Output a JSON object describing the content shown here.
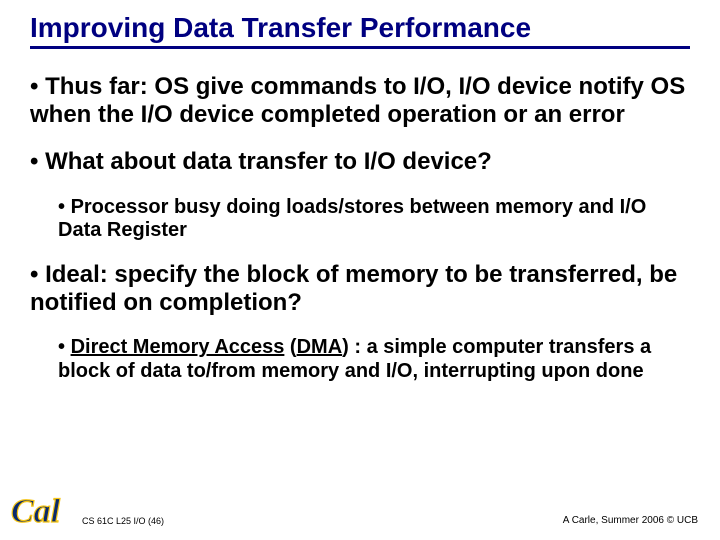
{
  "title": "Improving Data Transfer Performance",
  "bullet1": "Thus far: OS give commands to I/O, I/O device notify OS when the I/O device completed operation or an error",
  "bullet2": "What about data transfer to I/O device?",
  "bullet2a": "Processor busy doing loads/stores between memory and I/O Data Register",
  "bullet3": "Ideal: specify the block of memory to be transferred, be notified on completion?",
  "bullet3a_pre": "Direct Memory Access",
  "bullet3a_mid": " (",
  "bullet3a_dma": "DMA",
  "bullet3a_post": ") : a simple computer transfers a block of data to/from memory and I/O, interrupting upon done",
  "footer_left": "CS 61C L25 I/O (46)",
  "footer_right": "A Carle, Summer 2006 © UCB",
  "logo_label": "Cal"
}
